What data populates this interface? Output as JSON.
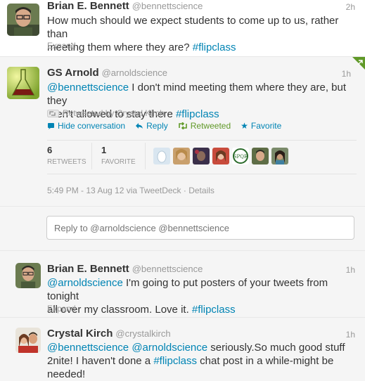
{
  "tweet1": {
    "name": "Brian E. Bennett",
    "handle": "@bennettscience",
    "time": "2h",
    "line1": "How much should we expect students to come up to us, rather than",
    "line2_prefix": "meeting them where they are? ",
    "hashtag": "#flipclass",
    "expand": "Expand"
  },
  "tweet2": {
    "name": "GS Arnold",
    "handle": "@arnoldscience",
    "time": "1h",
    "mention": "@bennettscience",
    "line1_rest": " I don't mind meeting them where they are, but they",
    "line2_prefix": "aren't allowed to stay there ",
    "hashtag": "#flipclass",
    "retweeted_by": "Retweeted by Crystal Kirch",
    "actions": {
      "hide": "Hide conversation",
      "reply": "Reply",
      "retweeted": "Retweeted",
      "favorite": "Favorite"
    },
    "stats": {
      "retweets_count": "6",
      "retweets_label": "RETWEETS",
      "favorites_count": "1",
      "favorites_label": "FAVORITE"
    },
    "meta": "5:49 PM - 13 Aug 12 via TweetDeck · Details"
  },
  "reply_box": {
    "placeholder": "Reply to @arnoldscience @bennettscience"
  },
  "tweet3": {
    "name": "Brian E. Bennett",
    "handle": "@bennettscience",
    "time": "1h",
    "mention": "@arnoldscience",
    "line1_rest": " I'm going to put posters of your tweets from tonight",
    "line2": "all over my classroom. Love it. ",
    "hashtag": "#flipclass",
    "expand": "Expand"
  },
  "tweet4": {
    "name": "Crystal Kirch",
    "handle": "@crystalkirch",
    "time": "1h",
    "mention1": "@bennettscience",
    "mention2": "@arnoldscience",
    "line1_rest": " seriously.So much good stuff",
    "line2_prefix": "2nite! I haven't done a ",
    "hashtag": "#flipclass",
    "line2_rest": " chat post in a while-might be",
    "line3": "needed!"
  },
  "colors": {
    "link": "#0084b4",
    "retweet": "#609928",
    "muted": "#999999"
  }
}
